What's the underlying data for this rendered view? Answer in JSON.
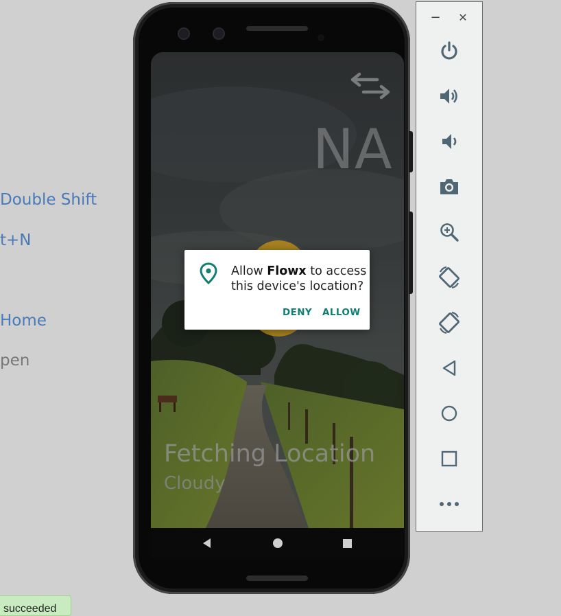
{
  "ide": {
    "hints": [
      {
        "text": "Double Shift",
        "style": "link"
      },
      {
        "text": "t+N",
        "style": "link"
      },
      {
        "text": "Home",
        "style": "link"
      },
      {
        "text": "pen",
        "style": "muted"
      }
    ],
    "toast": "succeeded"
  },
  "app": {
    "top_value": "NA",
    "status_title": "Fetching Location",
    "status_sub": "Cloudy",
    "swap_icon": "swap-arrows-icon"
  },
  "permission_dialog": {
    "prefix": "Allow ",
    "app_name": "Flowx",
    "suffix": " to access this device's location?",
    "icon": "location-pin-icon",
    "deny_label": "DENY",
    "allow_label": "ALLOW",
    "accent_color": "#0f7f73"
  },
  "android_nav": {
    "back": "back-triangle-icon",
    "home": "home-circle-icon",
    "recents": "recents-square-icon"
  },
  "emulator_toolbar": {
    "minimize": "−",
    "close": "✕",
    "buttons": [
      "power-icon",
      "volume-up-icon",
      "volume-down-icon",
      "camera-icon",
      "zoom-in-icon",
      "rotate-left-icon",
      "rotate-right-icon",
      "back-icon",
      "home-icon",
      "overview-icon",
      "more-icon"
    ]
  }
}
